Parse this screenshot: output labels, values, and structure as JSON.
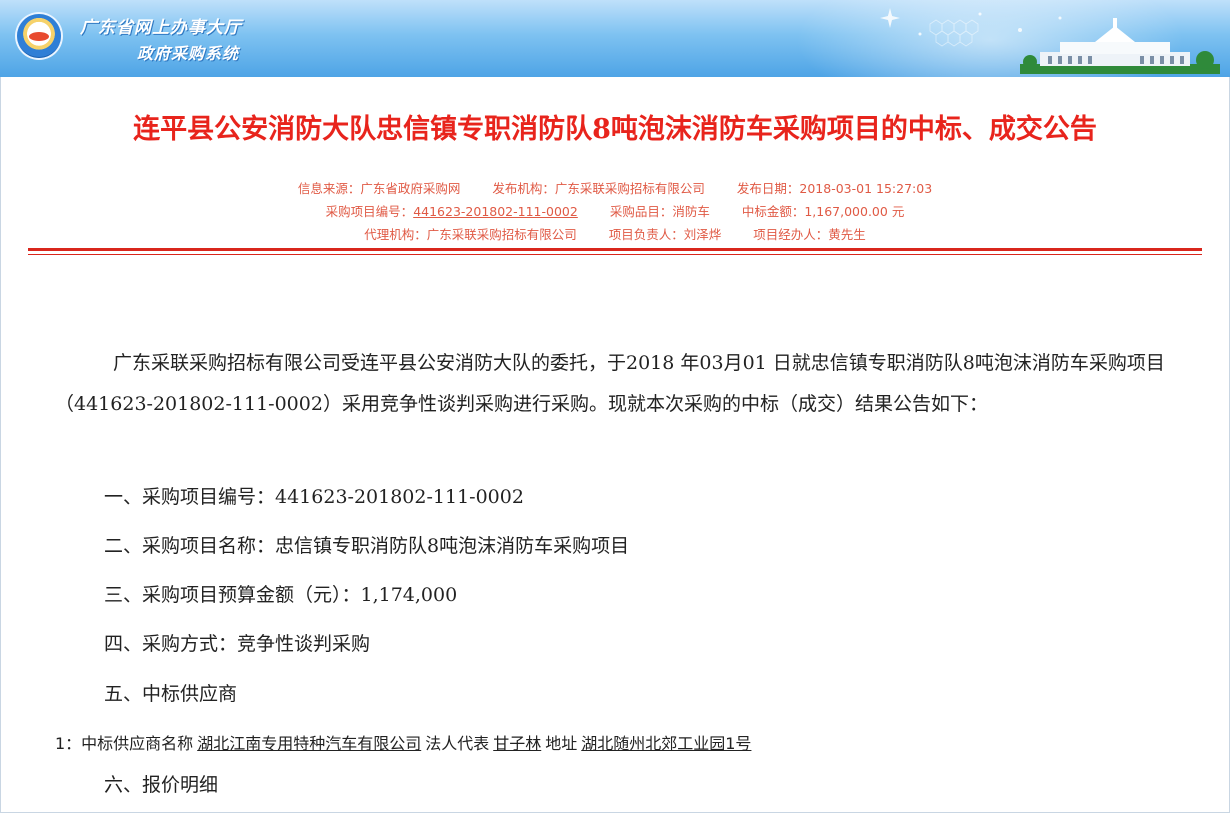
{
  "header": {
    "title": "广东省网上办事大厅",
    "subtitle": "政府采购系统"
  },
  "notice": {
    "title": "连平县公安消防大队忠信镇专职消防队8吨泡沫消防车采购项目的中标、成交公告",
    "meta": {
      "source_label": "信息来源：",
      "source": "广东省政府采购网",
      "publisher_label": "发布机构：",
      "publisher": "广东采联采购招标有限公司",
      "date_label": "发布日期：",
      "date": "2018-03-01 15:27:03",
      "project_no_label": "采购项目编号：",
      "project_no": "441623-201802-111-0002",
      "category_label": "采购品目：",
      "category": "消防车",
      "amount_label": "中标金额：",
      "amount": "1,167,000.00 元",
      "agency_label": "代理机构：",
      "agency": "广东采联采购招标有限公司",
      "manager_label": "项目负责人：",
      "manager": "刘泽烨",
      "handler_label": "项目经办人：",
      "handler": "黄先生"
    }
  },
  "content": {
    "intro": "广东采联采购招标有限公司受连平县公安消防大队的委托，于2018 年03月01 日就忠信镇专职消防队8吨泡沫消防车采购项目（441623-201802-111-0002）采用竞争性谈判采购进行采购。现就本次采购的中标（成交）结果公告如下：",
    "items": [
      "一、采购项目编号：441623-201802-111-0002",
      "二、采购项目名称：忠信镇专职消防队8吨泡沫消防车采购项目",
      "三、采购项目预算金额（元）：1,174,000",
      "四、采购方式：竞争性谈判采购",
      "五、中标供应商"
    ],
    "supplier": {
      "prefix": "1：中标供应商名称",
      "name": "湖北江南专用特种汽车有限公司",
      "rep_label": "法人代表",
      "rep": "甘子林",
      "addr_label": "地址",
      "addr": "湖北随州北郊工业园1号"
    },
    "item6": "六、报价明细"
  },
  "colors": {
    "title_red": "#e8241c",
    "meta_red": "#e05a45",
    "header_blue": "#4ea4e6"
  }
}
